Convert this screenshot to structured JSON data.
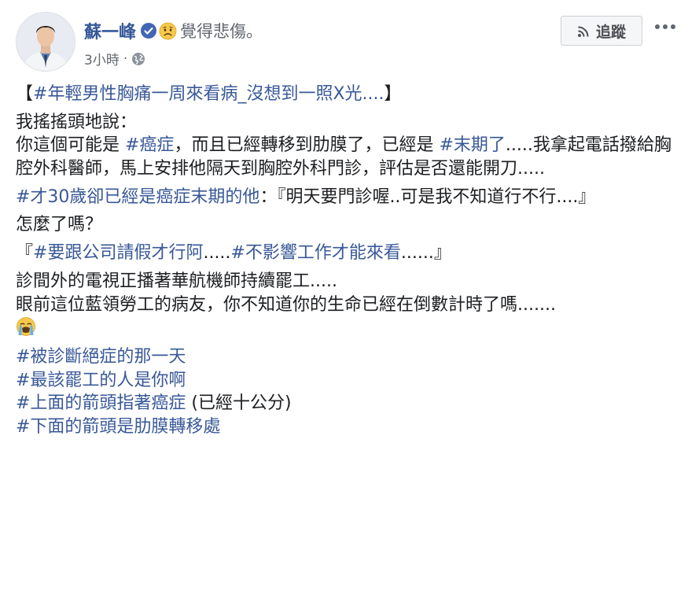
{
  "post": {
    "author": "蘇一峰",
    "feeling": "覺得悲傷。",
    "time": "3小時",
    "meta_dot": "·",
    "follow_label": "追蹤"
  },
  "content": {
    "title_open": "【",
    "title_tag": "#年輕男性胸痛一周來看病_沒想到一照X光....",
    "title_close": "】",
    "p1_l1": "我搖搖頭地說：",
    "p1_l2a": "你這個可能是 ",
    "p1_tag1": "#癌症",
    "p1_l2b": "，而且已經轉移到肋膜了，已經是 ",
    "p1_tag2": "#末期了",
    "p1_l2c": ".....我拿起電話撥給胸腔外科醫師，馬上安排他隔天到胸腔外科門診，評估是否還能開刀.....",
    "p2_tag": "#才30歲卻已經是癌症末期的他",
    "p2_text": "：『明天要門診喔..可是我不知道行不行....』",
    "p3": "怎麼了嗎？",
    "p4_open": "『",
    "p4_tag1": "#要跟公司請假才行阿",
    "p4_mid": ".....",
    "p4_tag2": "#不影響工作才能來看",
    "p4_close": "......』",
    "p5_l1": "診間外的電視正播著華航機師持續罷工.....",
    "p5_l2": "眼前這位藍領勞工的病友，你不知道你的生命已經在倒數計時了嗎.......",
    "hashtags": [
      {
        "tag": "#被診斷絕症的那一天",
        "extra": ""
      },
      {
        "tag": "#最該罷工的人是你啊",
        "extra": ""
      },
      {
        "tag": "#上面的箭頭指著癌症",
        "extra": " (已經十公分)"
      },
      {
        "tag": "#下面的箭頭是肋膜轉移處",
        "extra": ""
      }
    ]
  },
  "icons": {
    "verified": "verified-badge-icon",
    "feeling": "sad-face-emoji",
    "privacy": "globe-icon",
    "follow": "rss-icon",
    "more": "ellipsis-icon",
    "crying": "loudly-crying-emoji"
  },
  "colors": {
    "link": "#385898",
    "author": "#365899",
    "text": "#1c1e21",
    "meta": "#616770"
  }
}
